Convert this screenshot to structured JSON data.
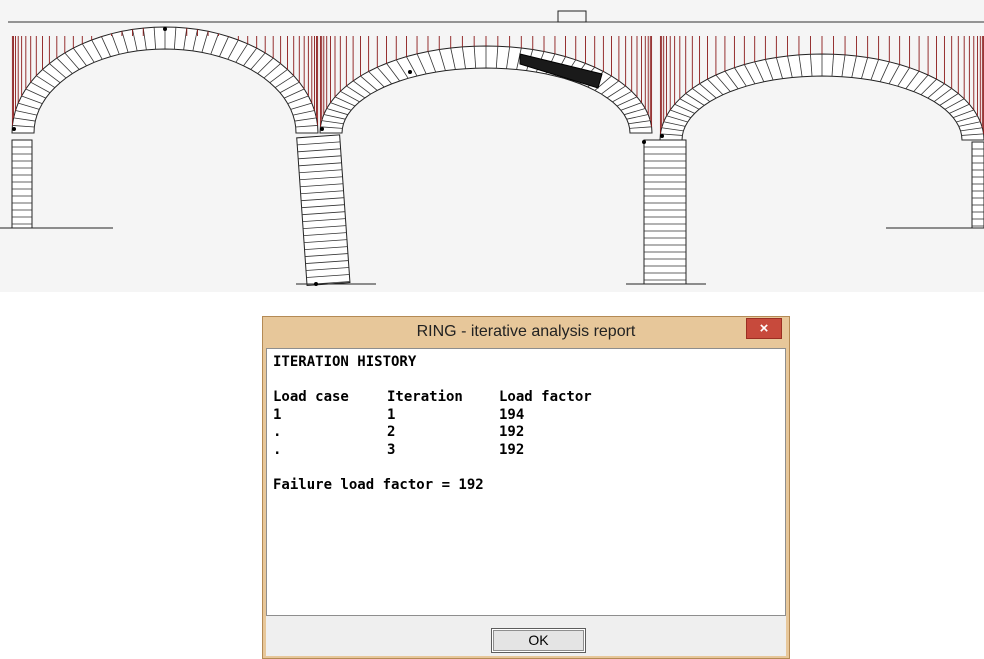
{
  "dialog": {
    "title": "RING - iterative analysis report",
    "close_label": "×",
    "ok_label": "OK"
  },
  "report": {
    "heading": "ITERATION HISTORY",
    "columns": [
      "Load case",
      "Iteration",
      "Load factor"
    ],
    "rows": [
      [
        "1",
        "1",
        "194"
      ],
      [
        ".",
        "2",
        "192"
      ],
      [
        ".",
        "3",
        "192"
      ]
    ],
    "failure": "Failure load factor = 192"
  },
  "colors": {
    "load_arrows": "#8b1a1a",
    "hinge_block": "#1a1a1a",
    "dialog_frame": "#e7c79a",
    "close_button": "#c74a3c"
  }
}
